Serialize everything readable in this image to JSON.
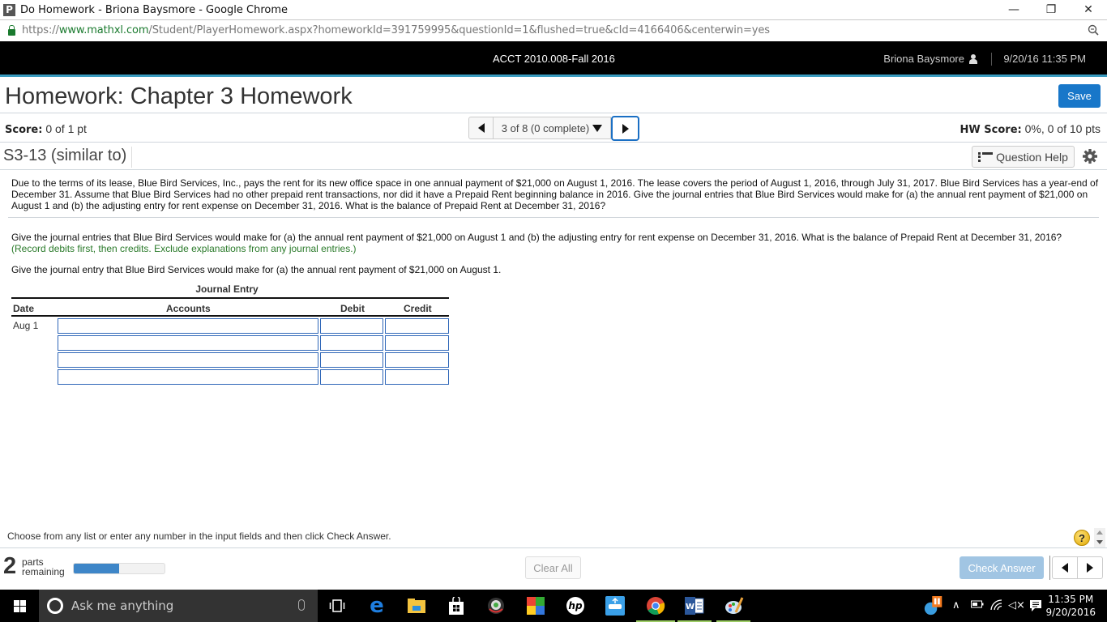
{
  "browser": {
    "window_title": "Do Homework - Briona Baysmore - Google Chrome",
    "app_icon_letter": "P",
    "url_scheme": "https://",
    "url_host": "www.mathxl.com",
    "url_path": "/Student/PlayerHomework.aspx?homeworkId=391759995&questionId=1&flushed=true&cId=4166406&centerwin=yes",
    "controls": {
      "minimize": "—",
      "restore": "❐",
      "close": "✕"
    }
  },
  "header": {
    "course": "ACCT 2010.008-Fall 2016",
    "user": "Briona Baysmore",
    "datetime": "9/20/16 11:35 PM"
  },
  "homework": {
    "title": "Homework: Chapter 3 Homework",
    "save_label": "Save",
    "score_label": "Score:",
    "score_value": " 0 of 1 pt",
    "pager_text": "3 of 8 (0 complete)",
    "hw_score_label": "HW Score:",
    "hw_score_value": " 0%, 0 of 10 pts",
    "question_id": "S3-13 (similar to)",
    "question_help_label": "Question Help"
  },
  "question": {
    "problem_text": "Due to the terms of its lease, Blue Bird Services, Inc., pays the rent for its new office space in one annual payment of $21,000 on August 1, 2016. The lease covers the period of August 1, 2016, through July 31, 2017. Blue Bird Services has a year-end of December 31. Assume that Blue Bird Services had no other prepaid rent transactions, nor did it have a Prepaid Rent beginning balance in 2016. Give the journal entries that Blue Bird Services would make for (a) the annual rent payment of $21,000 on August 1 and (b) the adjusting entry for rent expense on December 31, 2016. What is the balance of Prepaid Rent at December 31, 2016?",
    "instruction_text": "Give the journal entries that Blue Bird Services would make for (a) the annual rent payment of $21,000 on August 1 and (b) the adjusting entry for rent expense on December 31, 2016. What is the balance of Prepaid Rent at December 31, 2016?",
    "instruction_note": "(Record debits first, then credits. Exclude explanations from any journal entries.)",
    "part_a_prompt": "Give the journal entry that Blue Bird Services would make for (a) the annual rent payment of $21,000 on August 1."
  },
  "journal": {
    "title": "Journal Entry",
    "columns": {
      "date": "Date",
      "accounts": "Accounts",
      "debit": "Debit",
      "credit": "Credit"
    },
    "rows": [
      {
        "date": "Aug 1",
        "account": "",
        "debit": "",
        "credit": ""
      },
      {
        "date": "",
        "account": "",
        "debit": "",
        "credit": ""
      },
      {
        "date": "",
        "account": "",
        "debit": "",
        "credit": ""
      },
      {
        "date": "",
        "account": "",
        "debit": "",
        "credit": ""
      }
    ]
  },
  "footer": {
    "hint": "Choose from any list or enter any number in the input fields and then click Check Answer.",
    "help_symbol": "?",
    "parts_count": "2",
    "parts_label_1": "parts",
    "parts_label_2": "remaining",
    "progress_fraction": 0.5,
    "clear_all_label": "Clear All",
    "check_answer_label": "Check Answer"
  },
  "taskbar": {
    "search_placeholder": "Ask me anything",
    "clock_time": "11:35 PM",
    "clock_date": "9/20/2016",
    "apps": [
      "task-view",
      "edge",
      "file-explorer",
      "store",
      "webcam",
      "puzzle-app",
      "hp",
      "network-app",
      "chrome",
      "word",
      "paint"
    ]
  },
  "colors": {
    "accent": "#1877c9",
    "header_bg": "#000000",
    "header_border": "#3a9cc0",
    "check_answer_disabled": "#a1c5e3",
    "progress_fill": "#3e86c8",
    "note_green": "#2a7a2a",
    "input_border": "#2f67b8"
  }
}
